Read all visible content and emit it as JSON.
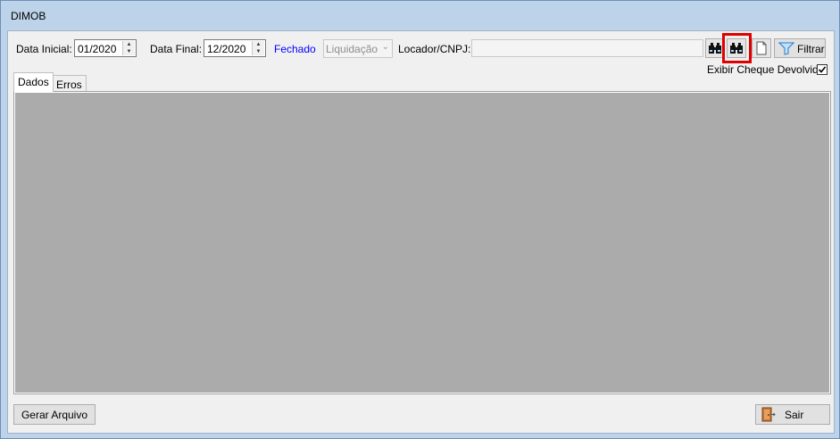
{
  "window": {
    "title": "DIMOB"
  },
  "filters": {
    "data_inicial_label": "Data Inicial:",
    "data_inicial_value": "01/2020",
    "data_final_label": "Data Final:",
    "data_final_value": "12/2020",
    "status_link": "Fechado",
    "status_link_color": "#0000ff",
    "liquidacao_value": "Liquidação",
    "locador_label": "Locador/CNPJ:",
    "locador_value": "",
    "filtrar_label": "Filtrar",
    "exibir_cheque_label": "Exibir Cheque Devolvido",
    "exibir_cheque_checked": true
  },
  "toolbar_icons": [
    "binoculars-icon",
    "binoculars-icon",
    "document-icon",
    "funnel-icon"
  ],
  "highlight_color": "#e00000",
  "tabs": [
    {
      "label": "Dados",
      "active": true
    },
    {
      "label": "Erros",
      "active": false
    }
  ],
  "footer": {
    "gerar_label": "Gerar Arquivo",
    "sair_label": "Sair"
  }
}
